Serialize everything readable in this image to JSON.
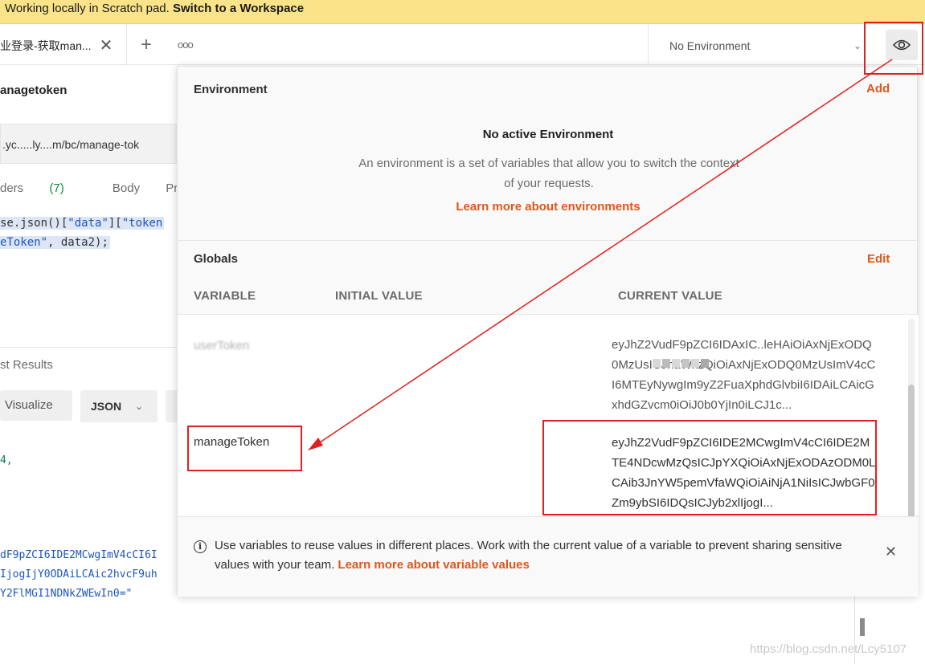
{
  "banner": {
    "text": "Working locally in Scratch pad.",
    "link": "Switch to a Workspace"
  },
  "tab": {
    "label": "业登录-获取man...",
    "close": "✕",
    "add": "+",
    "more": "ooo"
  },
  "env_select": {
    "value": "No Environment",
    "chevron": "⌄"
  },
  "request": {
    "title": "anagetoken",
    "url": ".yc.....ly....m/bc/manage-tok",
    "tabs": [
      {
        "label": "ders"
      },
      {
        "label": "Body"
      },
      {
        "label": "Pre-requ"
      }
    ],
    "headers_count": "(7)",
    "code": [
      {
        "plain": "se.json()[",
        "s1": "\"data\"",
        "mid": "][",
        "s2": "\"token"
      },
      {
        "s1": "eToken\"",
        "plain": ", data2);"
      }
    ],
    "results_label": "st Results",
    "visualize_label": "Visualize",
    "json_label": "JSON",
    "response_lines": [
      "4,",
      "dF9pZCI6IDE2MCwgImV4cCI6I",
      "IjogIjY0ODAiLCAic2hvcF9uh",
      "Y2FlMGI1NDNkZWEwIn0=\""
    ]
  },
  "popover": {
    "env_title": "Environment",
    "env_action": "Add",
    "no_env_title": "No active Environment",
    "no_env_desc": "An environment is a set of variables that allow you to switch the context of your requests.",
    "no_env_link": "Learn more about environments",
    "globals_title": "Globals",
    "globals_action": "Edit",
    "columns": {
      "variable": "VARIABLE",
      "initial": "INITIAL VALUE",
      "current": "CURRENT VALUE"
    },
    "rows": [
      {
        "name": "userToken",
        "current": "eyJhZ2VudF9pZCI6IDAxIC..leHAiOiAxNjExODQ0MzUsICJhaWxzQiOiAxNjExODQ0MzUsImV4cCI6MTEyNywgIm9yZ2FuaXphdGlvbiI6IDAiLCAicGxhdGZvcm0iOiJ0b0YjIn0iLCJ1c..."
      },
      {
        "name": "manageToken",
        "current": "eyJhZ2VudF9pZCI6IDE2MCwgImV4cCI6IDE2MTE4NDcwMzQsICJpYXQiOiAxNjExODAzODM0LCAib3JnYW5pemVfaWQiOiAiNjA1NiIsICJwbGF0Zm9ybSI6IDQsICJyb2xlIjogI..."
      }
    ],
    "footer_text": "Use variables to reuse values in different places. Work with the current value of a variable to prevent sharing sensitive values with your team.",
    "footer_link": "Learn more about variable values",
    "footer_close": "✕"
  },
  "watermark": "https://blog.csdn.net/Lcy5107",
  "colors": {
    "accent": "#e0561b",
    "banner": "#fbe38a",
    "annotation": "#e02020"
  }
}
